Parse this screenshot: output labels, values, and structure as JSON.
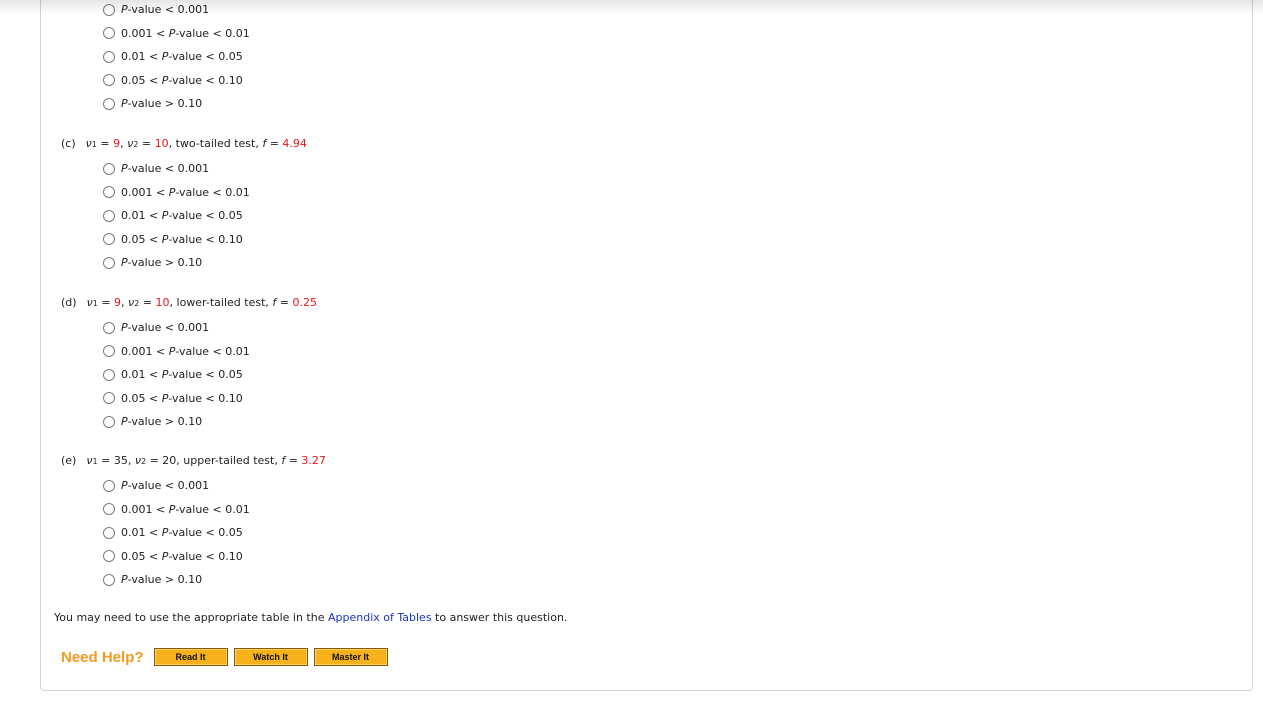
{
  "options": [
    {
      "pre": "",
      "mid": "P",
      "post": "-value < 0.001"
    },
    {
      "pre": "0.001 < ",
      "mid": "P",
      "post": "-value < 0.01"
    },
    {
      "pre": "0.01 < ",
      "mid": "P",
      "post": "-value < 0.05"
    },
    {
      "pre": "0.05 < ",
      "mid": "P",
      "post": "-value < 0.10"
    },
    {
      "pre": "",
      "mid": "P",
      "post": "-value > 0.10"
    }
  ],
  "parts": {
    "c": {
      "label": "(c)",
      "nu": "ν",
      "sub1": "1",
      "sub2": "2",
      "eq": " = ",
      "v1": "9",
      "sep": ", ",
      "v2": "10",
      "test": ", two-tailed test, ",
      "f": "f",
      "feq": " = ",
      "fval": "4.94"
    },
    "d": {
      "label": "(d)",
      "nu": "ν",
      "sub1": "1",
      "sub2": "2",
      "eq": " = ",
      "v1": "9",
      "sep": ", ",
      "v2": "10",
      "test": ", lower-tailed test, ",
      "f": "f",
      "feq": " = ",
      "fval": "0.25"
    },
    "e": {
      "label": "(e)",
      "nu": "ν",
      "sub1": "1",
      "sub2": "2",
      "eq": " = ",
      "v1": "35",
      "sep": ", ",
      "v2": "20",
      "test": ", upper-tailed test, ",
      "f": "f",
      "feq": " = ",
      "fval": "3.27"
    }
  },
  "note": {
    "before": "You may need to use the appropriate table in the ",
    "link": "Appendix of Tables",
    "after": " to answer this question."
  },
  "help": {
    "label": "Need Help?",
    "read": "Read It",
    "watch": "Watch It",
    "master": "Master It"
  },
  "colors": {
    "given_value": "#e8161b",
    "link": "#1a34c8",
    "help_label": "#f39a1e",
    "help_button": "#f7b11b"
  }
}
